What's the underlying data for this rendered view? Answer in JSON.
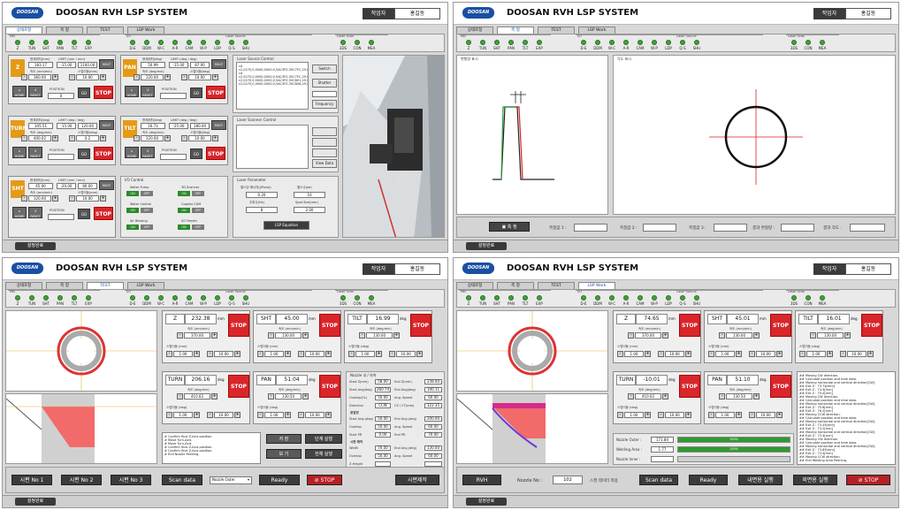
{
  "app": {
    "title": "DOOSAN RVH LSP SYSTEM",
    "logo": "DOOSAN",
    "operator_label": "작업자",
    "operator_name": "홍길동",
    "footer_button": "설정완료",
    "tabs": [
      "상태조정",
      "측 정",
      "TEST",
      "LSP Work"
    ]
  },
  "status_groups": {
    "mei": "MEI",
    "io": "I/O",
    "laser_source": "Laser Source",
    "laser_scan": "Laser Scan"
  },
  "status_items": [
    "Z",
    "TUN",
    "SHT",
    "PAN",
    "TLT",
    "EXP",
    "D-E",
    "DDM",
    "W-C",
    "A-R",
    "CAM",
    "W-P",
    "LDP",
    "Q-S",
    "SHU",
    "3DS",
    "CON",
    "MEA"
  ],
  "q1": {
    "axes": [
      {
        "id": "Z",
        "pos_label": "현재위치(mm)",
        "pos": "183.17",
        "limit_label": "LIMIT (mm / mm)",
        "lim_min": "-15.00",
        "lim_max": "1100.00",
        "speed_label": "속도 (mm/min)",
        "speed": "360.00",
        "step_label": "스텝이동(mm)",
        "step": "10.00",
        "home": "HOME",
        "reset": "RESET",
        "position_label": "POSITION",
        "position": "0",
        "go": "GO",
        "stop": "STOP",
        "mult": "MULT"
      },
      {
        "id": "PAN",
        "pos_label": "현재위치(deg)",
        "pos": "50.99",
        "limit_label": "LIMIT (deg / deg)",
        "lim_min": "-15.00",
        "lim_max": "87.00",
        "speed_label": "속도 (deg/min)",
        "speed": "120.00",
        "step_label": "스텝이동(deg)",
        "step": "10.00",
        "home": "HOME",
        "reset": "RESET",
        "position_label": "POSITION",
        "position": "",
        "go": "GO",
        "stop": "STOP",
        "mult": "MULT"
      },
      {
        "id": "TURN",
        "pos_label": "현재위치(deg)",
        "pos": "105.51",
        "limit_label": "LIMIT (deg / deg)",
        "lim_min": "-15.00",
        "lim_max": "120.00",
        "speed_label": "속도 (deg/min)",
        "speed": "400.02",
        "step_label": "스텝이동(deg)",
        "step": "0.2",
        "home": "HOME",
        "reset": "RESET",
        "position_label": "POSITION",
        "position": "",
        "go": "GO",
        "stop": "STOP",
        "mult": "MULT"
      },
      {
        "id": "TILT",
        "pos_label": "현재위치(deg)",
        "pos": "16.73",
        "limit_label": "LIMIT (deg / deg)",
        "lim_min": "-25.00",
        "lim_max": "180.00",
        "speed_label": "속도 (deg/min)",
        "speed": "120.00",
        "step_label": "스텝이동(deg)",
        "step": "10.00",
        "home": "HOME",
        "reset": "RESET",
        "position_label": "POSITION",
        "position": "",
        "go": "GO",
        "stop": "STOP",
        "mult": "MULT"
      },
      {
        "id": "SHT",
        "pos_label": "현재위치(mm)",
        "pos": "45.00",
        "limit_label": "LIMIT (mm / mm)",
        "lim_min": "-20.00",
        "lim_max": "80.00",
        "speed_label": "속도 (mm/min)",
        "speed": "120.00",
        "step_label": "스텝이동(mm)",
        "step": "10.00",
        "home": "HOME",
        "reset": "RESET",
        "position_label": "POSITION",
        "position": "",
        "go": "GO",
        "stop": "STOP",
        "mult": "MULT"
      }
    ],
    "io_control": {
      "title": "I/O Control",
      "items": [
        {
          "label": "Water Pump",
          "on": "ON",
          "off": "OFF"
        },
        {
          "label": "3D Scanner",
          "on": "ON",
          "off": "OFF"
        },
        {
          "label": "Water Control",
          "on": "ON",
          "off": "OFF"
        },
        {
          "label": "Cognex CAM",
          "on": "ON",
          "off": "OFF"
        },
        {
          "label": "Air Blowing",
          "on": "ON",
          "off": "OFF"
        },
        {
          "label": "I/O Feeder",
          "on": "ON",
          "off": "OFF"
        }
      ]
    },
    "laser_source_control": {
      "title": "Laser Source Control",
      "lines": [
        "cd",
        "c2,0270,0,0000,0000,0,5AC3F0,3VC7FC,29,0,21",
        "cd",
        "c2,0270,0,0000,0000,0,5AC3F0,3VC7FC,29,0,21",
        "c2,0270,0,0000,0000,0,5AC3F0,3VC801,29,0,21",
        "c2,0270,0,0000,0000,0,5AC3F0,3VC806,29,0,21"
      ],
      "switch": "Switch",
      "shutter": "Shutter",
      "frequency": "Frequency"
    },
    "laser_scanner_control": {
      "title": "Laser Scanner Control",
      "view_data": "View Data"
    },
    "laser_parameter": {
      "title": "Laser Parameter",
      "pulse_energy_label": "펄스당 에너지(J/Pulse)",
      "pulse_energy": "0.20",
      "pulse_count_label": "펄스수(ea)",
      "pulse_count": "10",
      "freq_label": "주파수(Hz)",
      "freq": "8",
      "spot_label": "Spot Size(mm)",
      "spot": "2.00",
      "equation": "LSP Equation"
    }
  },
  "q2": {
    "left_title": "변형량 표시",
    "right_title": "각도 표시",
    "measure_button": "측 정",
    "m1_label": "측정값 1 :",
    "m2_label": "측정값 2 :",
    "m3_label": "측정값 3 :",
    "deform_label": "결과 변형량 :",
    "angle_label": "결과 각도 :"
  },
  "q3": {
    "cards": [
      {
        "axis": "Z",
        "value": "232.38",
        "unit": "mm",
        "speed_label": "속도 (mm/min)",
        "speed": "370.00",
        "step_label": "스텝이동 (mm)",
        "step_min": "1.00",
        "step_max": "10.00",
        "stop": "STOP"
      },
      {
        "axis": "SHT",
        "value": "45.00",
        "unit": "mm",
        "speed_label": "속도 (mm/min)",
        "speed": "130.00",
        "step_label": "스텝이동 (mm)",
        "step_min": "1.00",
        "step_max": "10.00",
        "stop": "STOP"
      },
      {
        "axis": "TILT",
        "value": "16.99",
        "unit": "deg",
        "speed_label": "속도 (deg/min)",
        "speed": "130.00",
        "step_label": "스텝이동 (deg)",
        "step_min": "1.00",
        "step_max": "10.00",
        "stop": "STOP"
      },
      {
        "axis": "TURN",
        "value": "206.16",
        "unit": "deg",
        "speed_label": "속도 (deg/min)",
        "speed": "410.02",
        "step_label": "스텝이동 (deg)",
        "step_min": "1.00",
        "step_max": "10.00",
        "stop": "STOP"
      },
      {
        "axis": "PAN",
        "value": "51.04",
        "unit": "deg",
        "speed_label": "속도 (deg/min)",
        "speed": "130.50",
        "step_label": "스텝이동 (deg)",
        "step_min": "1.00",
        "step_max": "10.00",
        "stop": "STOP"
      }
    ],
    "nozzle_panel": {
      "title": "Nozzle 내 / 외측",
      "rows": [
        {
          "l1": "Start Z(mm)",
          "v1": "58.00",
          "l2": "End Z(mm)",
          "v2": "238.00"
        },
        {
          "l1": "Start Ang(deg)",
          "v1": "260.74",
          "l2": "End Ang(deg)",
          "v2": "100.11"
        },
        {
          "l1": "Overlap(%)",
          "v1": "50.00",
          "l2": "Ang. Speed",
          "v2": "60.00"
        },
        {
          "l1": "Direction",
          "v1": "CCW",
          "l2": "CZ / CT(mm)",
          "v2": "122.35"
        }
      ],
      "section2": "용접면",
      "rows2": [
        {
          "l1": "Start Ang.(deg)",
          "v1": "50.00",
          "l2": "End Ang.(deg)",
          "v2": "200.00"
        },
        {
          "l1": "Overlap",
          "v1": "50.00",
          "l2": "Ang. Speed",
          "v2": "60.00"
        },
        {
          "l1": "Start PR",
          "v1": "0.00",
          "l2": "End PR",
          "v2": "70.00"
        }
      ],
      "section3": "시편 제작",
      "rows3": [
        {
          "l1": "Width",
          "v1": "70.00",
          "l2": "End Ang.(deg)",
          "v2": "130.00"
        },
        {
          "l1": "Overlap",
          "v1": "50.00",
          "l2": "Ang. Speed",
          "v2": "60.00"
        },
        {
          "l1": "Z-Height",
          "v1": "",
          "l2": "",
          "v2": ""
        }
      ]
    },
    "log": [
      "# Confirm final Z-Axis position.",
      "# Move Turn-Axis",
      "# Move Turn-Axis",
      "# Confirm final Z-Axis position.",
      "# Confirm final Z-Axis position.",
      "# End Nozzle Peening."
    ],
    "save_btn": "저 장",
    "step_run_btn": "단계 실행",
    "view_btn": "보 기",
    "run_all_btn": "전체 실행",
    "bottom": {
      "s1": "시편 No 1",
      "s2": "시편 No 2",
      "s3": "시편 No 3",
      "scan": "Scan data",
      "select": "Nozzle Outer",
      "ready": "Ready",
      "stop": "STOP",
      "make": "시편제작"
    }
  },
  "q4": {
    "cards": [
      {
        "axis": "Z",
        "value": "74.65",
        "unit": "mm",
        "speed_label": "속도 (mm/min)",
        "speed": "370.00",
        "step_label": "스텝이동 (mm)",
        "step_min": "1.00",
        "step_max": "10.00",
        "stop": "STOP"
      },
      {
        "axis": "SHT",
        "value": "45.01",
        "unit": "mm",
        "speed_label": "속도 (mm/min)",
        "speed": "130.00",
        "step_label": "스텝이동 (mm)",
        "step_min": "1.00",
        "step_max": "10.00",
        "stop": "STOP"
      },
      {
        "axis": "TILT",
        "value": "16.01",
        "unit": "deg",
        "speed_label": "속도 (deg/min)",
        "speed": "130.00",
        "step_label": "스텝이동 (deg)",
        "step_min": "1.00",
        "step_max": "10.00",
        "stop": "STOP"
      },
      {
        "axis": "TURN",
        "value": "-10.01",
        "unit": "deg",
        "speed_label": "속도 (deg/min)",
        "speed": "410.02",
        "step_label": "스텝이동 (deg)",
        "step_min": "1.00",
        "step_max": "10.00",
        "stop": "STOP"
      },
      {
        "axis": "PAN",
        "value": "51.10",
        "unit": "deg",
        "speed_label": "속도 (deg/min)",
        "speed": "130.50",
        "step_label": "스텝이동 (deg)",
        "step_min": "1.00",
        "step_max": "10.00",
        "stop": "STOP"
      }
    ],
    "progress": [
      {
        "label": "Nozzle Outer :",
        "value": "171.80",
        "pct": 100,
        "text": "100%"
      },
      {
        "label": "Welding Area :",
        "value": "1.77",
        "pct": 100,
        "text": "100%"
      },
      {
        "label": "Nozzle Inner :",
        "value": "",
        "pct": 0,
        "text": ""
      }
    ],
    "log": [
      "## Moving CW direction.",
      "## Calculate position and time data.",
      "## Moving horizontal and vertical direction[CW].",
      "## Exit Z : 73.74[mm]",
      "## Exit Z : 74.4[mm]",
      "## Exit Z : 75.0[mm]",
      "## Moving CW direction.",
      "## Calculate position and time data.",
      "## Moving horizontal and vertical direction[CW].",
      "## Exit Z : 75.6[mm]",
      "## Exit Z : 76.2[mm]",
      "## Moving CCW direction.",
      "## Calculate position and time data.",
      "## Moving horizontal and vertical direction[CW].",
      "## Exit Z : 73.45[mm]",
      "## Exit Z : 73.2[mm]",
      "## Moving horizontal and vertical direction[CW].",
      "## Exit Z : 73.4[mm]",
      "## Moving CW direction.",
      "## Calculate position and time data.",
      "## Moving horizontal and vertical direction[CW].",
      "## Exit Z : 73.85[mm]",
      "## Exit Z : 73.4[mm]",
      "## Moving CCW direction.",
      "## End Welding Area Peening."
    ],
    "bottom": {
      "rvh": "RVH",
      "nozzle_no_label": "Nozzle No :",
      "nozzle_no": "102",
      "scan_apply": "스캔 데이터 적용",
      "scan": "Scan data",
      "ready": "Ready",
      "inner": "내면용 실행",
      "outer": "외면용 실행",
      "stop": "STOP"
    }
  },
  "colors": {
    "accent_orange": "#e49a16",
    "stop_red": "#d8262b",
    "ok_green": "#3fa335",
    "brand_blue": "#1a4fa3",
    "dark_btn": "#3c3c3c"
  }
}
